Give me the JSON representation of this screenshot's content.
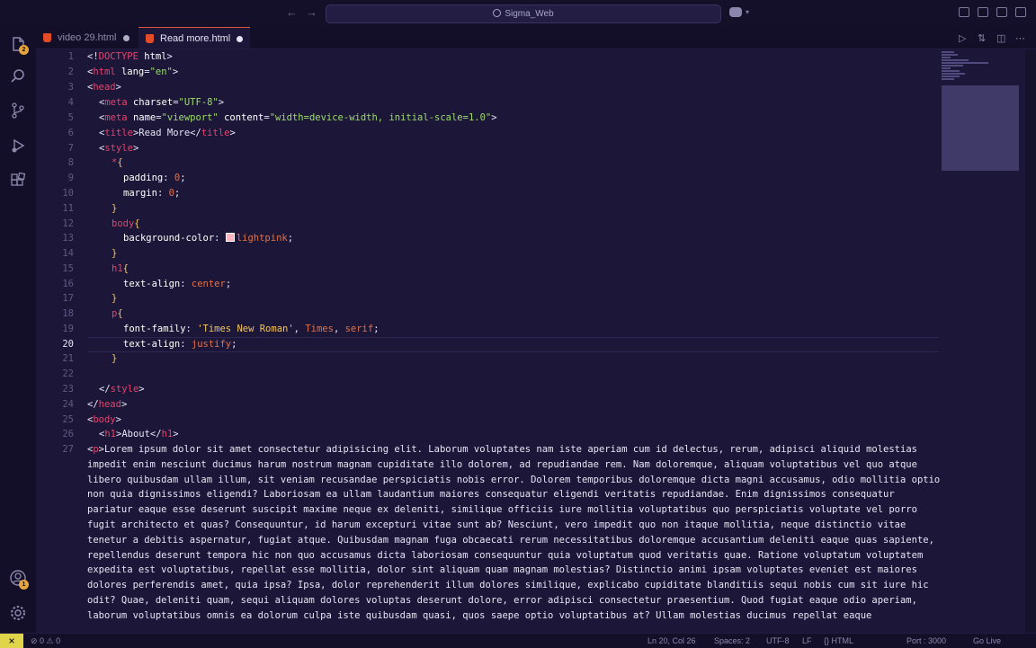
{
  "title_bar": {
    "search_text": "Sigma_Web",
    "icons": [
      "back-arrow-icon",
      "forward-arrow-icon",
      "copilot-icon",
      "layout-sidebar-left-icon",
      "layout-panel-icon",
      "layout-sidebar-right-icon",
      "customize-layout-icon"
    ]
  },
  "activity_bar": {
    "items": [
      "explorer-icon",
      "search-icon",
      "source-control-icon",
      "run-debug-icon",
      "extensions-icon"
    ],
    "explorer_badge": "2",
    "bottom": [
      "account-icon",
      "manage-gear-icon"
    ],
    "account_badge": "1"
  },
  "tabs": [
    {
      "label": "video 29.html",
      "active": false,
      "modified": true
    },
    {
      "label": "Read more.html",
      "active": true,
      "modified": true
    }
  ],
  "editor": {
    "current_line": 20,
    "line_numbers": [
      "1",
      "2",
      "3",
      "4",
      "5",
      "6",
      "7",
      "8",
      "9",
      "10",
      "11",
      "12",
      "13",
      "14",
      "15",
      "16",
      "17",
      "18",
      "19",
      "20",
      "21",
      "22",
      "23",
      "24",
      "25",
      "26",
      "27"
    ],
    "code": {
      "l1": [
        "<!",
        "DOCTYPE",
        " html",
        ">"
      ],
      "l2": [
        "<",
        "html",
        " lang",
        "=",
        "\"en\"",
        ">"
      ],
      "l3": [
        "<",
        "head",
        ">"
      ],
      "l4": [
        "<",
        "meta",
        " charset",
        "=",
        "\"UTF-8\"",
        ">"
      ],
      "l5": [
        "<",
        "meta",
        " name",
        "=",
        "\"viewport\"",
        " content",
        "=",
        "\"width=device-width, initial-scale=1.0\"",
        ">"
      ],
      "l6": [
        "<",
        "title",
        ">",
        "Read More",
        "</",
        "title",
        ">"
      ],
      "l7": [
        "<",
        "style",
        ">"
      ],
      "l8": [
        "*",
        "{"
      ],
      "l9": [
        "padding",
        ": ",
        "0",
        ";"
      ],
      "l10": [
        "margin",
        ": ",
        "0",
        ";"
      ],
      "l11": [
        "}"
      ],
      "l12": [
        "body",
        "{"
      ],
      "l13": [
        "background-color",
        ": ",
        "lightpink",
        ";"
      ],
      "l14": [
        "}"
      ],
      "l15": [
        "h1",
        "{"
      ],
      "l16": [
        "text-align",
        ": ",
        "center",
        ";"
      ],
      "l17": [
        "}"
      ],
      "l18": [
        "p",
        "{"
      ],
      "l19": [
        "font-family",
        ": ",
        "'Times New Roman'",
        ", ",
        "Times",
        ", ",
        "serif",
        ";"
      ],
      "l20": [
        "text-align",
        ": ",
        "justify",
        ";"
      ],
      "l21": [
        "}"
      ],
      "l23": [
        "</",
        "style",
        ">"
      ],
      "l24": [
        "</",
        "head",
        ">"
      ],
      "l25": [
        "<",
        "body",
        ">"
      ],
      "l26": [
        "<",
        "h1",
        ">",
        "About",
        "</",
        "h1",
        ">"
      ],
      "l27_open": [
        "<",
        "p",
        ">"
      ],
      "l27_text": "Lorem ipsum dolor sit amet consectetur adipisicing elit. Laborum voluptates nam iste aperiam cum id delectus, rerum, adipisci aliquid molestias impedit enim nesciunt ducimus harum nostrum magnam cupiditate illo dolorem, ad repudiandae rem. Nam doloremque, aliquam voluptatibus vel quo atque libero quibusdam ullam illum, sit veniam recusandae perspiciatis nobis error. Dolorem temporibus doloremque dicta magni accusamus, odio mollitia optio non quia dignissimos eligendi? Laboriosam ea ullam laudantium maiores consequatur eligendi veritatis repudiandae. Enim dignissimos consequatur pariatur eaque esse deserunt suscipit maxime neque ex deleniti, similique officiis iure mollitia voluptatibus quo perspiciatis voluptate vel porro fugit architecto et quas? Consequuntur, id harum excepturi vitae sunt ab? Nesciunt, vero impedit quo non itaque mollitia, neque distinctio vitae tenetur a debitis aspernatur, fugiat atque. Quibusdam magnam fuga obcaecati rerum necessitatibus doloremque accusantium deleniti eaque quas sapiente, repellendus deserunt tempora hic non quo accusamus dicta laboriosam consequuntur quia voluptatum quod veritatis quae. Ratione voluptatum voluptatem expedita est voluptatibus, repellat esse mollitia, dolor sint aliquam quam magnam molestias? Distinctio animi ipsam voluptates eveniet est maiores dolores perferendis amet, quia ipsa? Ipsa, dolor reprehenderit illum dolores similique, explicabo cupiditate blanditiis sequi nobis cum sit iure hic odit? Quae, deleniti quam, sequi aliquam dolores voluptas deserunt dolore, error adipisci consectetur praesentium. Quod fugiat eaque odio aperiam, laborum voluptatibus omnis ea dolorum culpa iste quibusdam quasi, quos saepe optio voluptatibus at? Ullam molestias ducimus repellat eaque"
    }
  },
  "status_bar": {
    "remote": "⨯",
    "problems": "⊘ 0  ⚠ 0",
    "cursor": "Ln 20, Col 26",
    "spaces": "Spaces: 2",
    "encoding": "UTF-8",
    "eol": "LF",
    "language": "{} HTML",
    "port": "Port : 3000",
    "live": "Go Live"
  },
  "colors": {
    "background": "#1c1738",
    "tag": "#e6436d",
    "attr_value": "#9ddb6b",
    "css_value": "#e0724a",
    "string": "#f4c65a",
    "swatch": "#ffb6c1"
  }
}
